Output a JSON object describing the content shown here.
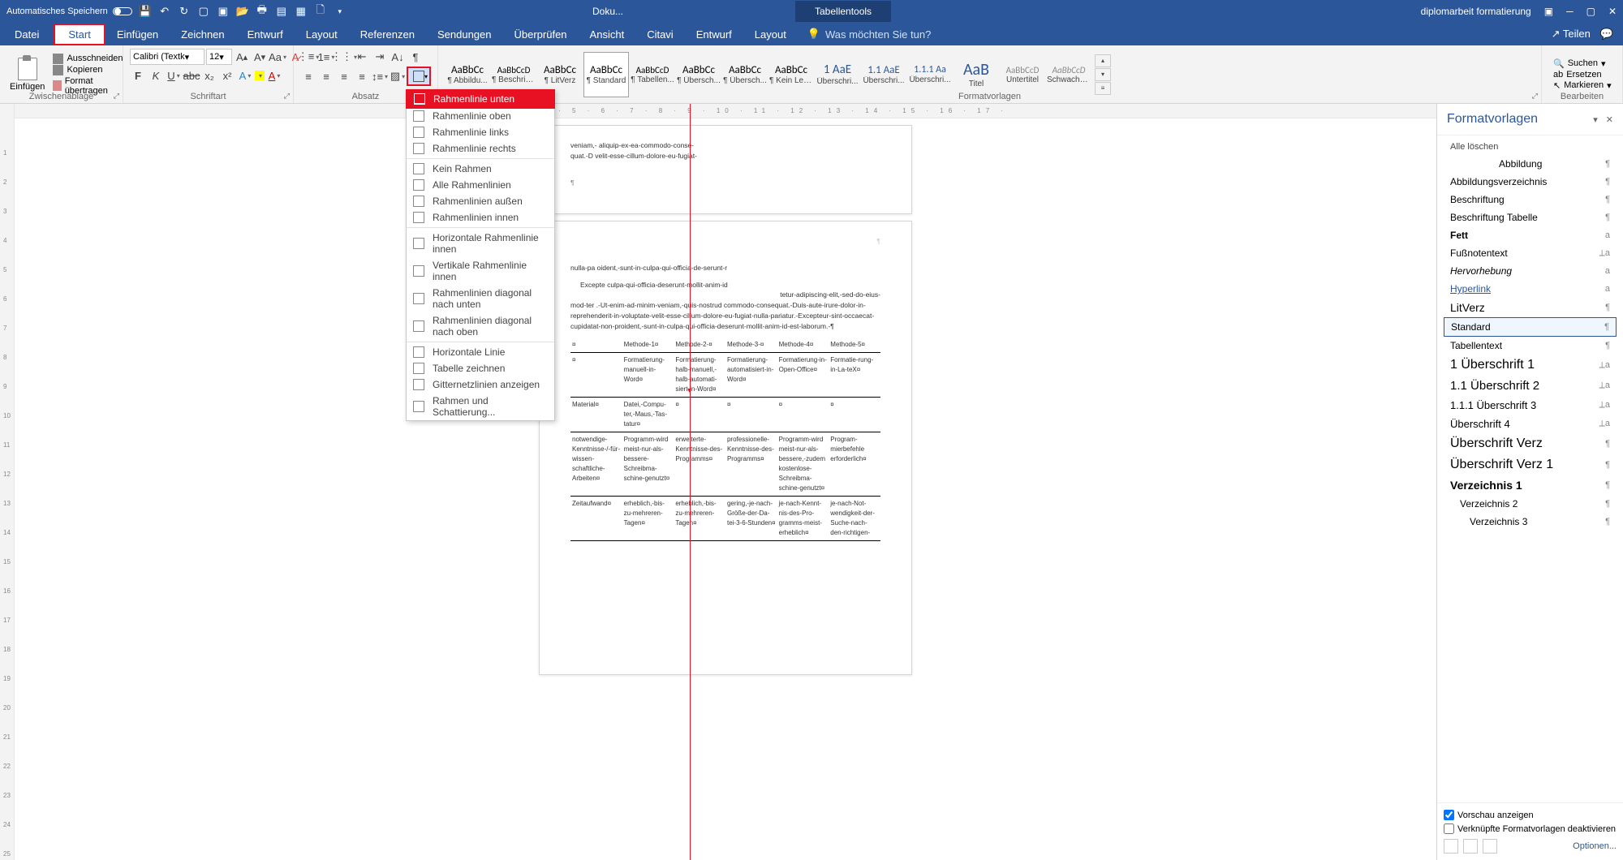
{
  "titlebar": {
    "autosave_label": "Automatisches Speichern",
    "doc_title": "Doku...",
    "tabletools": "Tabellentools",
    "filename": "diplomarbeit formatierung",
    "share": "Teilen"
  },
  "menubar": {
    "tabs": [
      "Datei",
      "Start",
      "Einfügen",
      "Zeichnen",
      "Entwurf",
      "Layout",
      "Referenzen",
      "Sendungen",
      "Überprüfen",
      "Ansicht",
      "Citavi",
      "Entwurf",
      "Layout"
    ],
    "tell_me": "Was möchten Sie tun?"
  },
  "ribbon": {
    "clipboard_label": "Zwischenablage",
    "paste": "Einfügen",
    "cut": "Ausschneiden",
    "copy": "Kopieren",
    "format_painter": "Format übertragen",
    "font_label": "Schriftart",
    "font_name": "Calibri (Textk",
    "font_size": "12",
    "para_label": "Absatz",
    "styles_label": "Formatvorlagen",
    "edit_label": "Bearbeiten",
    "find": "Suchen",
    "replace": "Ersetzen",
    "select": "Markieren",
    "styles": [
      {
        "preview": "AaBbCc",
        "name": "¶ Abbildu...",
        "size": "13px"
      },
      {
        "preview": "AaBbCcD",
        "name": "¶ Beschrift...",
        "size": "11px"
      },
      {
        "preview": "AaBbCc",
        "name": "¶ LitVerz",
        "size": "13px"
      },
      {
        "preview": "AaBbCc",
        "name": "¶ Standard",
        "size": "13px",
        "sel": true
      },
      {
        "preview": "AaBbCcD",
        "name": "¶ Tabellen...",
        "size": "11px"
      },
      {
        "preview": "AaBbCc",
        "name": "¶ Übersch...",
        "size": "13px"
      },
      {
        "preview": "AaBbCc",
        "name": "¶ Übersch...",
        "size": "13px"
      },
      {
        "preview": "AaBbCc",
        "name": "¶ Kein Lee...",
        "size": "13px"
      },
      {
        "preview": "1  AaE",
        "name": "Überschri...",
        "size": "15px",
        "color": "#2b579a"
      },
      {
        "preview": "1.1  AaE",
        "name": "Überschri...",
        "size": "13px",
        "color": "#2b579a"
      },
      {
        "preview": "1.1.1  Aa",
        "name": "Überschri...",
        "size": "12px",
        "color": "#2b579a"
      },
      {
        "preview": "AaB",
        "name": "Titel",
        "size": "20px",
        "color": "#2b579a"
      },
      {
        "preview": "AaBbCcD",
        "name": "Untertitel",
        "size": "11px",
        "color": "#888"
      },
      {
        "preview": "AaBbCcD",
        "name": "Schwache...",
        "size": "11px",
        "color": "#888",
        "italic": true
      }
    ]
  },
  "borders_menu": [
    {
      "label": "Rahmenlinie unten",
      "hl": true,
      "icon": "bottom"
    },
    {
      "label": "Rahmenlinie oben"
    },
    {
      "label": "Rahmenlinie links"
    },
    {
      "label": "Rahmenlinie rechts"
    },
    {
      "sep": true
    },
    {
      "label": "Kein Rahmen"
    },
    {
      "label": "Alle Rahmenlinien"
    },
    {
      "label": "Rahmenlinien außen"
    },
    {
      "label": "Rahmenlinien innen"
    },
    {
      "sep": true
    },
    {
      "label": "Horizontale Rahmenlinie innen"
    },
    {
      "label": "Vertikale Rahmenlinie innen"
    },
    {
      "label": "Rahmenlinien diagonal nach unten"
    },
    {
      "label": "Rahmenlinien diagonal nach oben"
    },
    {
      "sep": true
    },
    {
      "label": "Horizontale Linie"
    },
    {
      "label": "Tabelle zeichnen"
    },
    {
      "label": "Gitternetzlinien anzeigen"
    },
    {
      "label": "Rahmen und Schattierung..."
    }
  ],
  "doc": {
    "p1": "veniam,-                                                    aliquip-ex-ea-commodo-conse-",
    "p1b": "quat.-D                                                     velit-esse-cillum-dolore-eu-fugiat-",
    "p2a": "nulla-pa                                                    oident,-sunt-in-culpa-qui-officia-de-serunt-r",
    "p2b": "Excepte                                                     culpa-qui-officia-deserunt-mollit-anim-id",
    "p2c": "mod-ter                                                     .-Ut-enim-ad-minim-veniam,-quis-nostrud                                                      commodo-consequat.-Duis-aute-irure-dolor-in-reprehenderit-in-voluptate-velit-esse-cillum-dolore-eu-fugiat-nulla-pariatur.-Excepteur-sint-occaecat-cupidatat-non-proident,-sunt-in-culpa-qui-officia-deserunt-mollit-anim-id-est-laborum.-¶",
    "p2b2": "tetur-adipiscing-elit,-sed-do-eius-",
    "tbl_hdr": [
      "¤",
      "Methode-1¤",
      "Methode-2-¤",
      "Methode-3-¤",
      "Methode-4¤",
      "Methode-5¤"
    ],
    "tbl_rows": [
      [
        "¤",
        "Formatierung-manuell-in-Word¤",
        "Formatierung-halb-manuell,-halb-automati-siert-in-Word¤",
        "Formatierung-automatisiert-in-Word¤",
        "Formatierung-in-Open-Office¤",
        "Formatie-rung-in-La-teX¤"
      ],
      [
        "Material¤",
        "Datei,-Compu-ter,-Maus,-Tas-tatur¤",
        "¤",
        "¤",
        "¤",
        "¤"
      ],
      [
        "notwendige-Kenntnisse-/-für-wissen-schaftliche-Arbeiten¤",
        "Programm-wird meist-nur-als-bessere-Schreibma-schine-genutzt¤",
        "erweiterte-Kenntnisse-des-Programms¤",
        "professionelle-Kenntnisse-des-Programms¤",
        "Programm-wird meist-nur-als-bessere,-zudem kostenlose-Schreibma-schine-genutzt¤",
        "Program-mierbefehle erforderlich¤"
      ],
      [
        "Zeitaufwand¤",
        "erheblich,-bis-zu-mehreren-Tagen¤",
        "erheblich,-bis-zu-mehreren-Tagen¤",
        "gering,-je-nach-Größe-der-Da-tei-3-6-Stunden¤",
        "je-nach-Kennt-nis-des-Pro-gramms-meist-erheblich¤",
        "je-nach-Not-wendigkeit-der-Suche-nach-den-richtigen-"
      ]
    ]
  },
  "styles_pane": {
    "title": "Formatvorlagen",
    "clear_all": "Alle löschen",
    "items": [
      {
        "name": "Abbildung",
        "mark": "¶",
        "indent": 60
      },
      {
        "name": "Abbildungsverzeichnis",
        "mark": "¶"
      },
      {
        "name": "Beschriftung",
        "mark": "¶"
      },
      {
        "name": "Beschriftung Tabelle",
        "mark": "¶"
      },
      {
        "name": "Fett",
        "mark": "a",
        "bold": true
      },
      {
        "name": "Fußnotentext",
        "mark": "⟂a"
      },
      {
        "name": "Hervorhebung",
        "mark": "a",
        "italic": true
      },
      {
        "name": "Hyperlink",
        "mark": "a",
        "color": "#2b579a",
        "underline": true
      },
      {
        "name": "LitVerz",
        "mark": "¶",
        "size": "14px"
      },
      {
        "name": "Standard",
        "mark": "¶",
        "sel": true
      },
      {
        "name": "Tabellentext",
        "mark": "¶"
      },
      {
        "name": "1   Überschrift 1",
        "mark": "⟂a",
        "size": "16px"
      },
      {
        "name": "1.1  Überschrift 2",
        "mark": "⟂a",
        "size": "15px"
      },
      {
        "name": "1.1.1 Überschrift 3",
        "mark": "⟂a",
        "size": "13px"
      },
      {
        "name": "Überschrift 4",
        "mark": "⟂a",
        "size": "13px"
      },
      {
        "name": "Überschrift Verz",
        "mark": "¶",
        "size": "16px"
      },
      {
        "name": "Überschrift Verz 1",
        "mark": "¶",
        "size": "16px"
      },
      {
        "name": "Verzeichnis 1",
        "mark": "¶",
        "bold": true,
        "size": "14px"
      },
      {
        "name": "Verzeichnis 2",
        "mark": "¶",
        "indent": 12
      },
      {
        "name": "Verzeichnis 3",
        "mark": "¶",
        "indent": 24
      }
    ],
    "preview_cb": "Vorschau anzeigen",
    "linked_cb": "Verknüpfte Formatvorlagen deaktivieren",
    "options": "Optionen..."
  }
}
